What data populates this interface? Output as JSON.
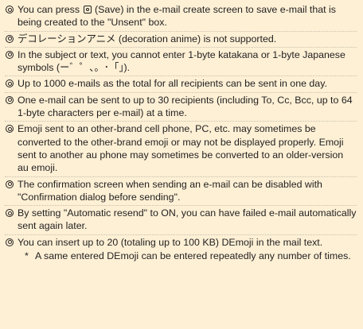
{
  "notes": [
    {
      "text_pre": "You can press ",
      "key_icon": "save-key-icon",
      "text_post": " (Save) in the e-mail create screen to save e-mail that is being created to the \"Unsent\" box."
    },
    {
      "text": "デコレーションアニメ (decoration anime) is not supported."
    },
    {
      "text": "In the subject or text, you cannot enter 1-byte katakana or 1-byte Japanese symbols (ー゛゜、。･「」)."
    },
    {
      "text": "Up to 1000 e-mails as the total for all recipients can be sent in one day."
    },
    {
      "text": "One e-mail can be sent to up to 30 recipients (including To, Cc, Bcc, up to 64 1-byte characters per e-mail) at a time."
    },
    {
      "text": "Emoji sent to an other-brand cell phone, PC, etc. may sometimes be converted to the other-brand emoji or may not be displayed properly. Emoji sent to another au phone may sometimes be converted to an older-version au emoji."
    },
    {
      "text": "The confirmation screen when sending an e-mail can be disabled with \"Confirmation dialog before sending\"."
    },
    {
      "text": "By setting \"Automatic resend\" to ON, you can have failed e-mail automatically sent again later."
    },
    {
      "text": "You can insert up to 20 (totaling up to 100 KB) DEmoji in the mail text.",
      "sub": {
        "mark": "*",
        "text": "A same entered DEmoji can be entered repeatedly any number of times."
      }
    }
  ],
  "colors": {
    "background": "#fdf0d5",
    "text": "#231f20",
    "divider": "#c9bfae"
  },
  "bullet_icon": "double-circle-icon"
}
